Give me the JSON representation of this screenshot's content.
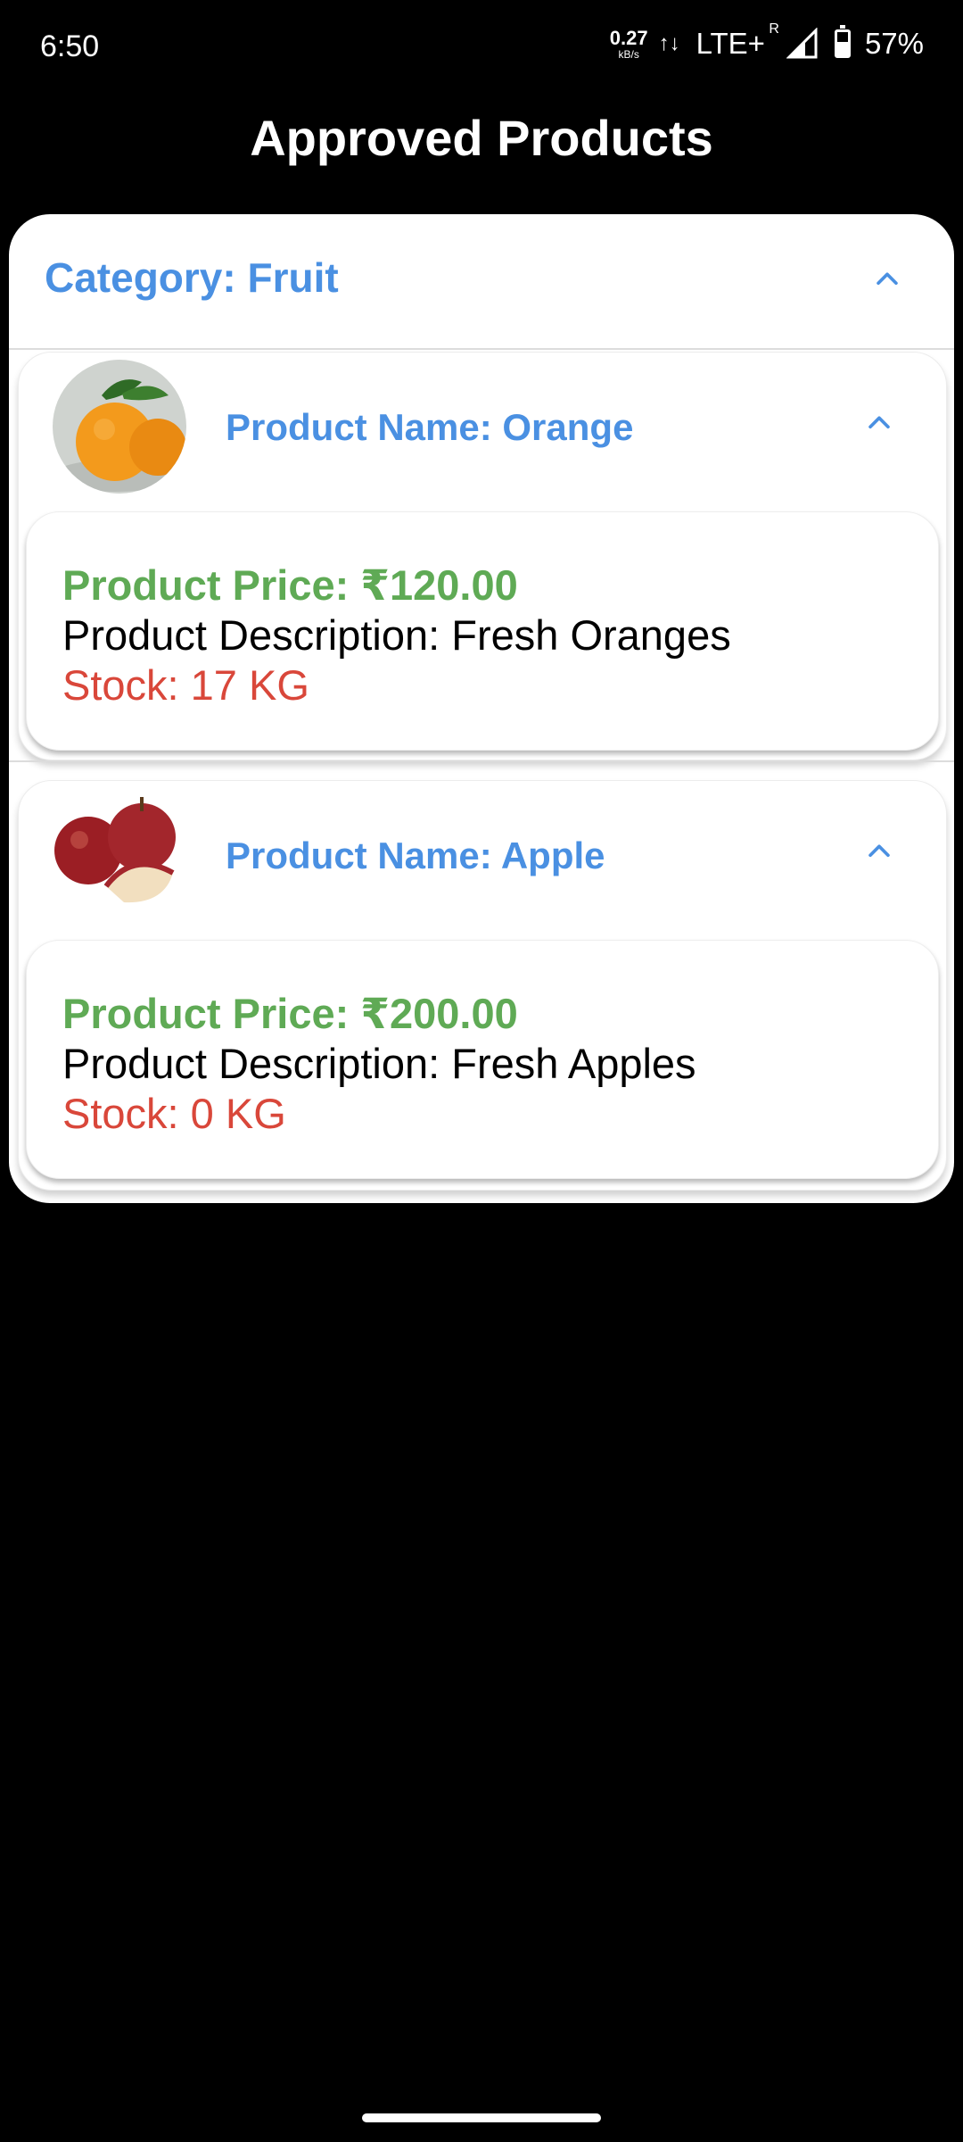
{
  "status_bar": {
    "time": "6:50",
    "net_rate": "0.27",
    "net_unit": "kB/s",
    "network": "LTE+",
    "roaming": "R",
    "battery": "57%",
    "battery_level": 0.57
  },
  "app_bar": {
    "title": "Approved Products"
  },
  "category": {
    "title": "Category: Fruit",
    "products": [
      {
        "name": "Product Name: Orange",
        "price": "Product Price: ₹120.00",
        "description": "Product Description: Fresh Oranges",
        "stock": "Stock: 17 KG",
        "image_icon": "orange-image"
      },
      {
        "name": "Product Name: Apple",
        "price": "Product Price: ₹200.00",
        "description": "Product Description: Fresh Apples",
        "stock": "Stock: 0 KG",
        "image_icon": "apple-image"
      }
    ]
  },
  "colors": {
    "accent": "#4a90e2",
    "price": "#5faa55",
    "stock": "#d9473a",
    "background": "#000000"
  }
}
